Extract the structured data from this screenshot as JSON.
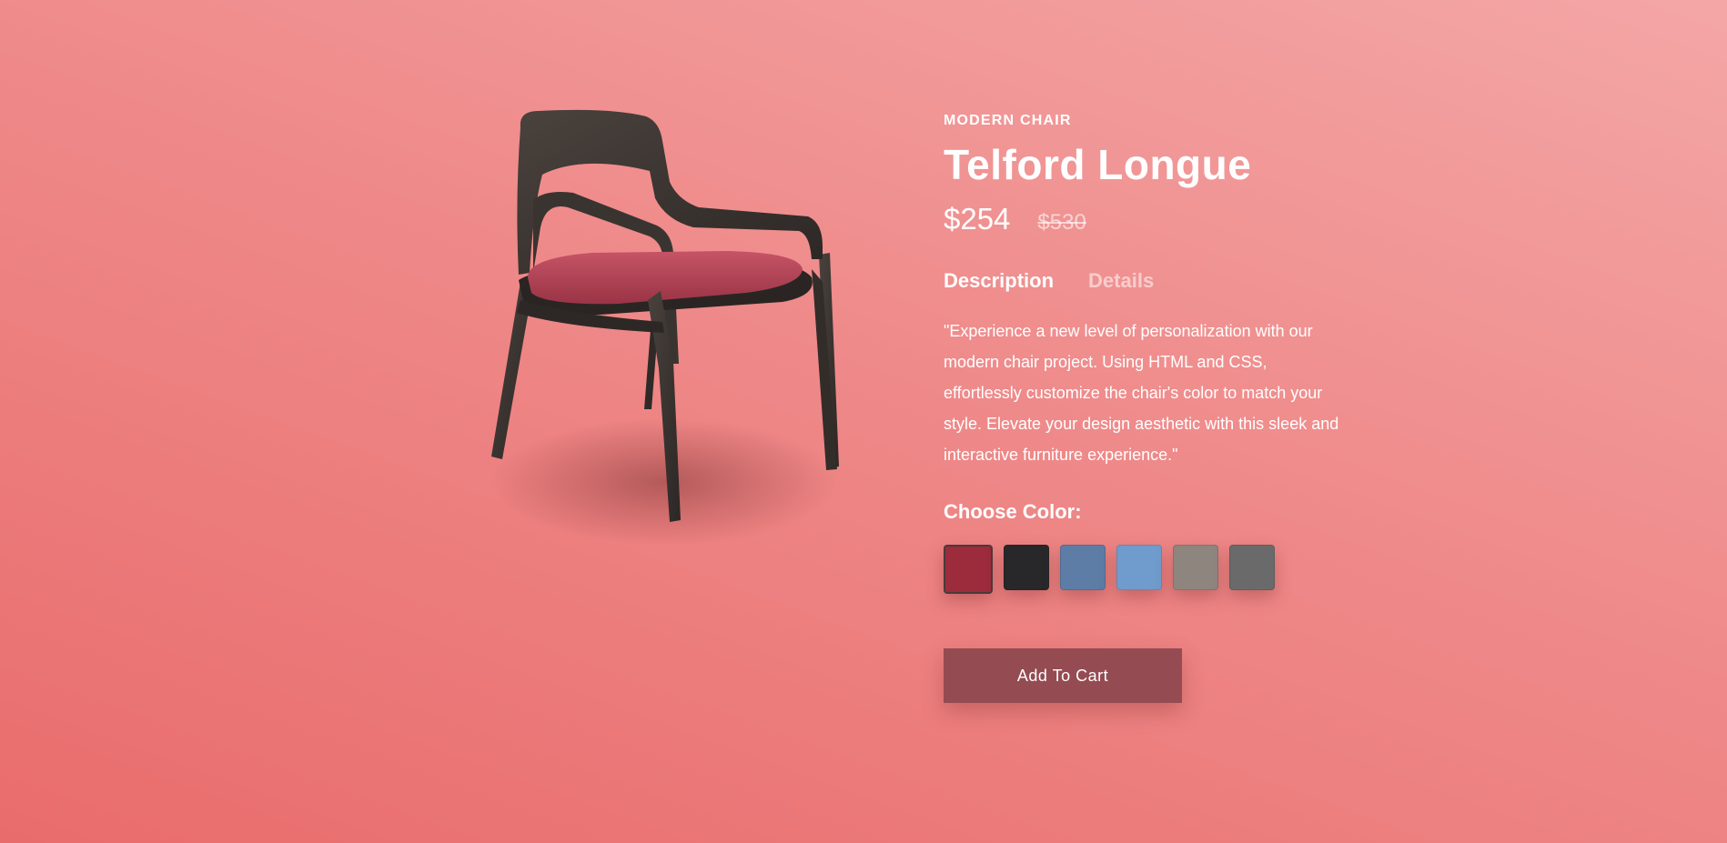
{
  "product": {
    "category": "MODERN CHAIR",
    "name": "Telford Longue",
    "price": "$254",
    "old_price": "$530",
    "tabs": [
      {
        "label": "Description",
        "active": true
      },
      {
        "label": "Details",
        "active": false
      }
    ],
    "description": "\"Experience a new level of personalization with our modern chair project. Using HTML and CSS, effortlessly customize the chair's color to match your style. Elevate your design aesthetic with this sleek and interactive furniture experience.\"",
    "choose_color_label": "Choose Color:",
    "colors": [
      {
        "name": "red-fabric",
        "hex": "#9c2b3c",
        "selected": true
      },
      {
        "name": "black-fabric",
        "hex": "#28282a",
        "selected": false
      },
      {
        "name": "denim-fabric",
        "hex": "#5d7da6",
        "selected": false
      },
      {
        "name": "light-blue-fabric",
        "hex": "#6f9ccc",
        "selected": false
      },
      {
        "name": "taupe-fabric",
        "hex": "#8f857f",
        "selected": false
      },
      {
        "name": "grey-fabric",
        "hex": "#6a6a6a",
        "selected": false
      }
    ],
    "add_to_cart_label": "Add To Cart"
  },
  "theme": {
    "background_top": "#f4a6a6",
    "background_bottom": "#e96c6c",
    "button_color": "#954b52",
    "chair_wood": "#3a3431",
    "chair_seat": "#b84a5c"
  }
}
